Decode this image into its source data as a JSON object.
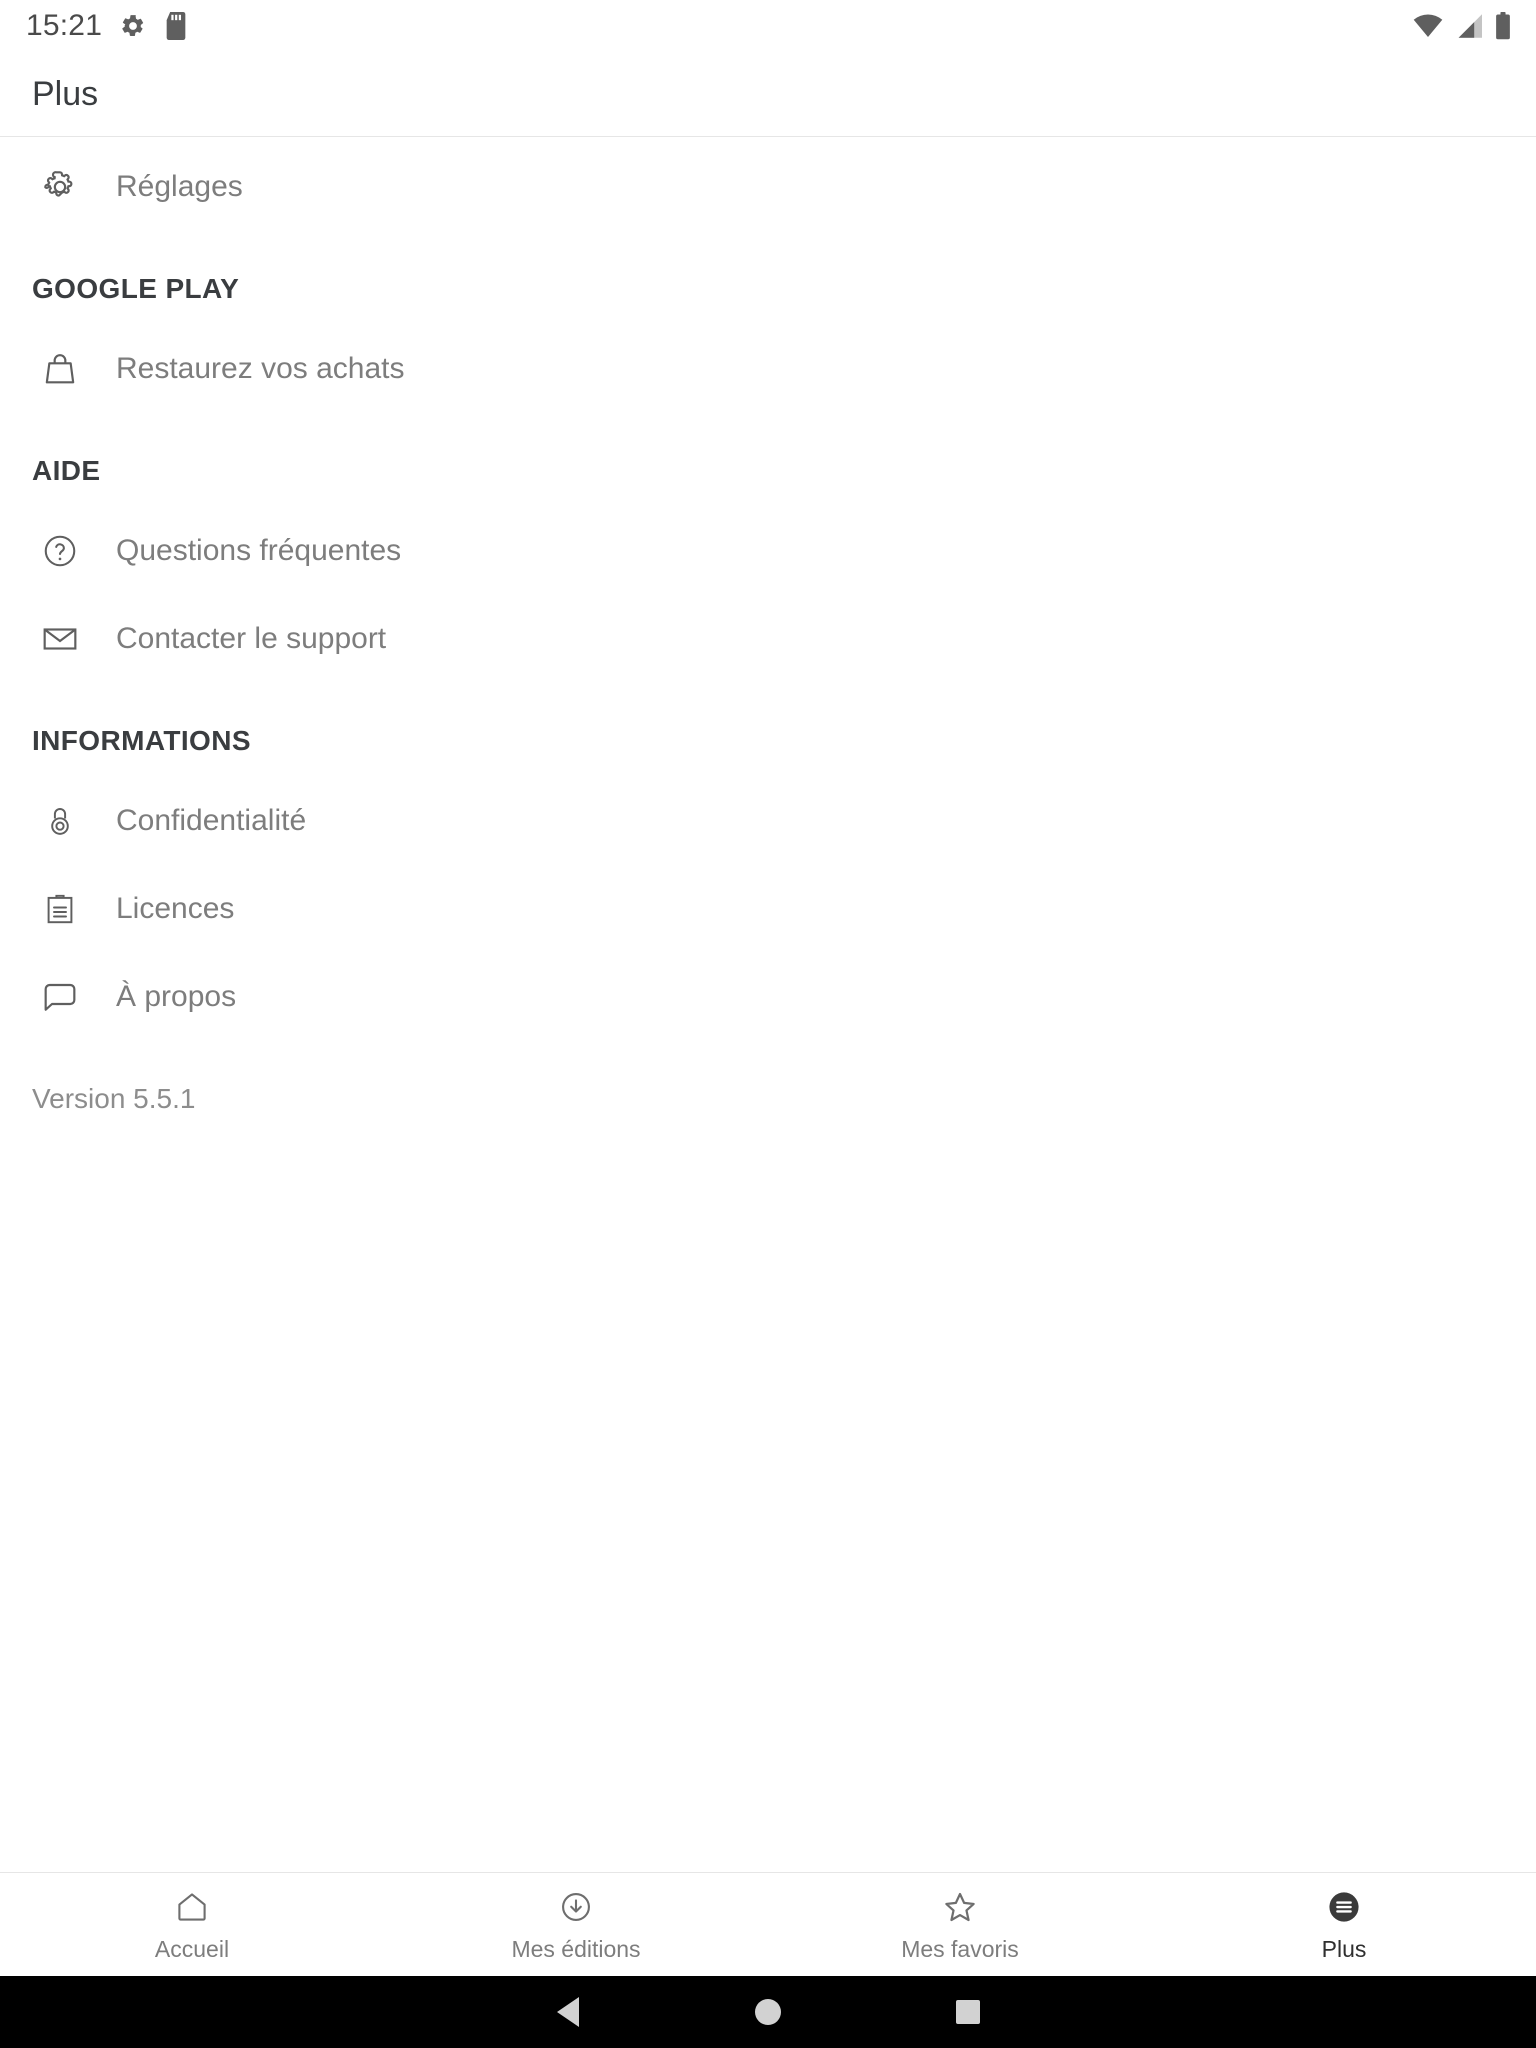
{
  "status_bar": {
    "time": "15:21",
    "left_icons": [
      "gear-icon",
      "sd-card-icon"
    ],
    "right_icons": [
      "wifi-icon",
      "cellular-signal-icon",
      "battery-icon"
    ]
  },
  "app_bar": {
    "title": "Plus"
  },
  "content": {
    "top_items": [
      {
        "icon": "gear-icon",
        "label": "Réglages"
      }
    ],
    "sections": [
      {
        "header": "GOOGLE PLAY",
        "items": [
          {
            "icon": "shopping-bag-icon",
            "label": "Restaurez vos achats"
          }
        ]
      },
      {
        "header": "AIDE",
        "items": [
          {
            "icon": "help-circle-icon",
            "label": "Questions fréquentes"
          },
          {
            "icon": "envelope-icon",
            "label": "Contacter le support"
          }
        ]
      },
      {
        "header": "INFORMATIONS",
        "items": [
          {
            "icon": "lock-icon",
            "label": "Confidentialité"
          },
          {
            "icon": "clipboard-icon",
            "label": "Licences"
          },
          {
            "icon": "speech-bubble-icon",
            "label": "À propos"
          }
        ]
      }
    ],
    "version": "Version 5.5.1"
  },
  "bottom_nav": {
    "items": [
      {
        "icon": "home-icon",
        "label": "Accueil",
        "active": false
      },
      {
        "icon": "download-circle-icon",
        "label": "Mes éditions",
        "active": false
      },
      {
        "icon": "star-icon",
        "label": "Mes favoris",
        "active": false
      },
      {
        "icon": "menu-circle-icon",
        "label": "Plus",
        "active": true
      }
    ]
  },
  "system_nav": {
    "buttons": [
      "back-button",
      "home-button",
      "recents-button"
    ]
  },
  "colors": {
    "background": "#ffffff",
    "title": "#3a3d40",
    "label": "#7d7d7d",
    "section_header": "#3a3d40",
    "divider": "#e6e6e6",
    "active_nav": "#2f2f2f",
    "system_nav_bg": "#000000"
  }
}
